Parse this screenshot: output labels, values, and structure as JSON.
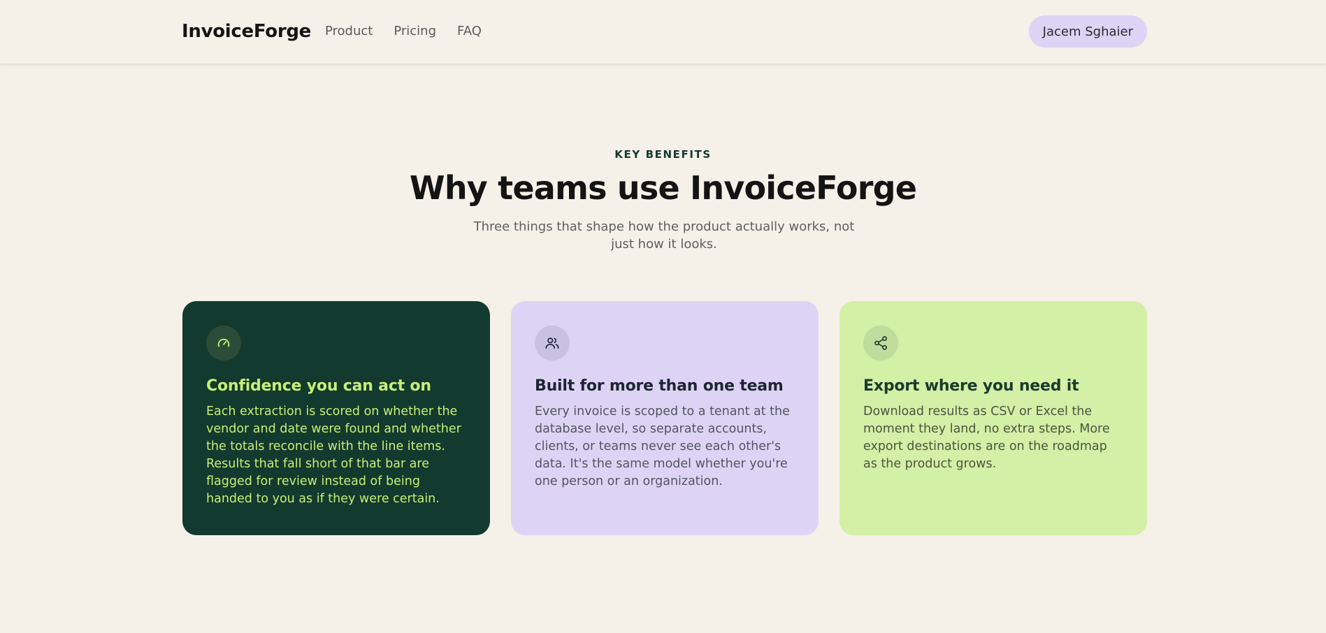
{
  "header": {
    "brand": "InvoiceForge",
    "nav": [
      {
        "label": "Product"
      },
      {
        "label": "Pricing"
      },
      {
        "label": "FAQ"
      }
    ],
    "user_name": "Jacem Sghaier"
  },
  "hero": {
    "eyebrow": "KEY BENEFITS",
    "title": "Why teams use InvoiceForge",
    "subtitle": "Three things that shape how the product actually works, not just how it looks."
  },
  "cards": [
    {
      "icon": "gauge-icon",
      "title": "Confidence you can act on",
      "body": "Each extraction is scored on whether the vendor and date were found and whether the totals reconcile with the line items. Results that fall short of that bar are flagged for review instead of being handed to you as if they were certain."
    },
    {
      "icon": "users-icon",
      "title": "Built for more than one team",
      "body": "Every invoice is scoped to a tenant at the database level, so separate accounts, clients, or teams never see each other's data. It's the same model whether you're one person or an organization."
    },
    {
      "icon": "share-icon",
      "title": "Export where you need it",
      "body": "Download results as CSV or Excel the moment they land, no extra steps. More export destinations are on the roadmap as the product grows."
    }
  ],
  "colors": {
    "page_bg": "#f5f0e8",
    "dark_green": "#133a2e",
    "lime": "#c6ef77",
    "lavender": "#ddd4f5",
    "light_green": "#d4efa6"
  }
}
